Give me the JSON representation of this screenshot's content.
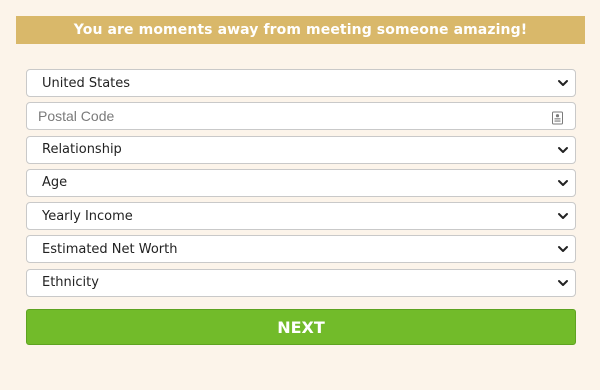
{
  "banner": {
    "text": "You are moments away from meeting someone amazing!"
  },
  "form": {
    "country": {
      "selected": "United States",
      "icon": "chevron-down-icon"
    },
    "postal_code": {
      "value": "",
      "placeholder": "Postal Code",
      "icon": "contact-card-icon"
    },
    "relationship": {
      "selected": "Relationship",
      "icon": "chevron-down-icon"
    },
    "age": {
      "selected": "Age",
      "icon": "chevron-down-icon"
    },
    "yearly_income": {
      "selected": "Yearly Income",
      "icon": "chevron-down-icon"
    },
    "net_worth": {
      "selected": "Estimated Net Worth",
      "icon": "chevron-down-icon"
    },
    "ethnicity": {
      "selected": "Ethnicity",
      "icon": "chevron-down-icon"
    }
  },
  "next_button": {
    "label": "NEXT"
  },
  "colors": {
    "page_background": "#fcf4ea",
    "banner_background": "#d9b86a",
    "banner_text": "#ffffff",
    "button_background": "#72bb2a",
    "button_text": "#ffffff",
    "field_border": "#c9c9c9"
  }
}
